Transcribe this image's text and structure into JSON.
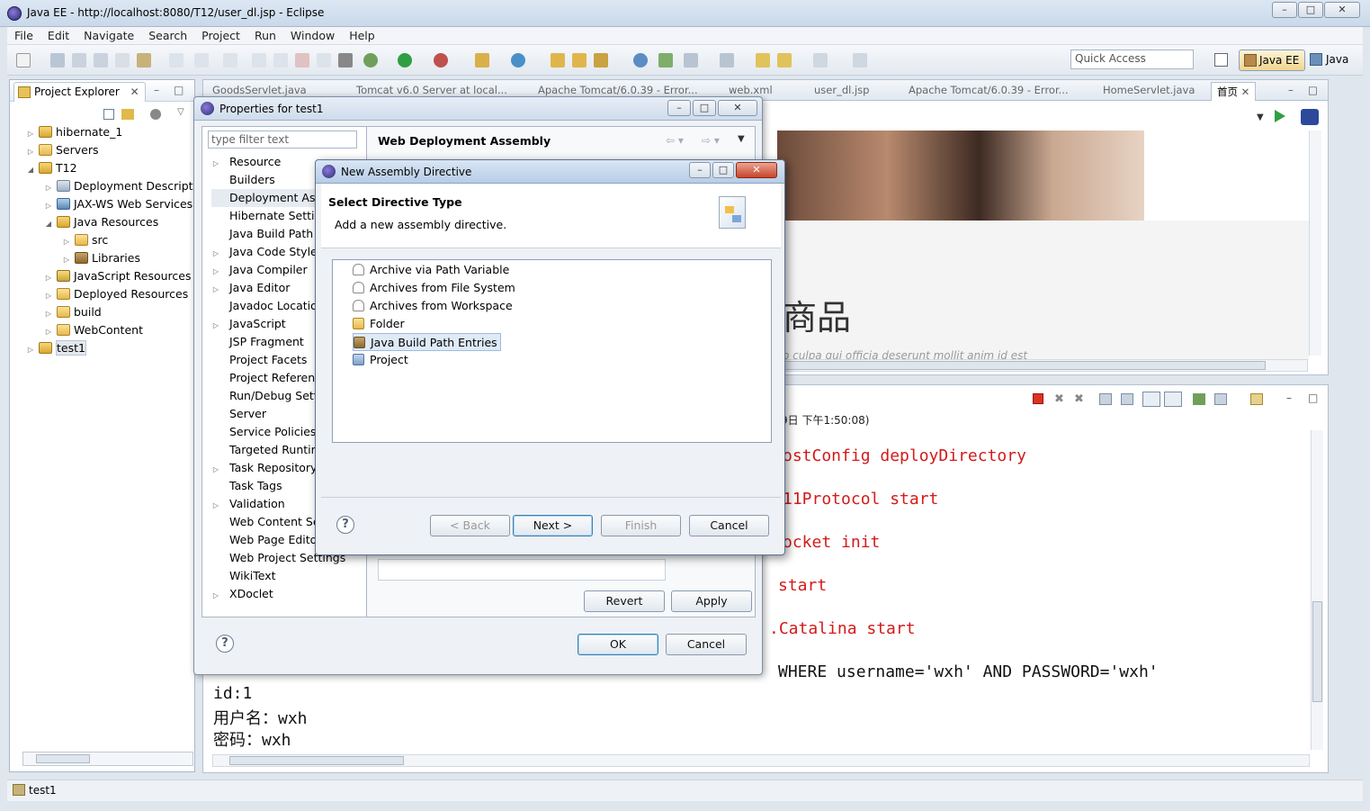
{
  "window": {
    "title": "Java EE - http://localhost:8080/T12/user_dl.jsp - Eclipse",
    "controls": [
      "–",
      "□",
      "✕"
    ]
  },
  "menu": [
    "File",
    "Edit",
    "Navigate",
    "Search",
    "Project",
    "Run",
    "Window",
    "Help"
  ],
  "toolbar": {
    "quick_access_placeholder": "Quick Access",
    "perspectives": [
      "Java EE",
      "Java"
    ]
  },
  "explorer": {
    "tab_label": "Project Explorer",
    "items": [
      {
        "label": "hibernate_1",
        "level": 0,
        "toggle": "▷",
        "icon": "project-icon"
      },
      {
        "label": "Servers",
        "level": 0,
        "toggle": "▷",
        "icon": "folder-icon"
      },
      {
        "label": "T12",
        "level": 0,
        "toggle": "◢",
        "icon": "project-icon"
      },
      {
        "label": "Deployment Descripto",
        "level": 1,
        "toggle": "▷",
        "icon": "descriptor-icon"
      },
      {
        "label": "JAX-WS Web Services",
        "level": 1,
        "toggle": "▷",
        "icon": "webservice-icon"
      },
      {
        "label": "Java Resources",
        "level": 1,
        "toggle": "◢",
        "icon": "java-resources-icon"
      },
      {
        "label": "src",
        "level": 2,
        "toggle": "▷",
        "icon": "source-folder-icon"
      },
      {
        "label": "Libraries",
        "level": 2,
        "toggle": "▷",
        "icon": "library-icon"
      },
      {
        "label": "JavaScript Resources",
        "level": 1,
        "toggle": "▷",
        "icon": "javascript-icon"
      },
      {
        "label": "Deployed Resources",
        "level": 1,
        "toggle": "▷",
        "icon": "folder-icon"
      },
      {
        "label": "build",
        "level": 1,
        "toggle": "▷",
        "icon": "folder-icon"
      },
      {
        "label": "WebContent",
        "level": 1,
        "toggle": "▷",
        "icon": "folder-icon"
      },
      {
        "label": "test1",
        "level": 0,
        "toggle": "▷",
        "icon": "project-icon"
      }
    ]
  },
  "editor_tabs": [
    "GoodsServlet.java",
    "Tomcat v6.0 Server at local...",
    "Apache Tomcat/6.0.39 - Error...",
    "web.xml",
    "user_dl.jsp",
    "Apache Tomcat/6.0.39 - Error...",
    "HomeServlet.java",
    "首页"
  ],
  "browser": {
    "heading": "商品",
    "faint_text": "o culpa qui officia deserunt mollit anim id est"
  },
  "console": {
    "title_fragment": "9日 下午1:50:08)",
    "red_lines": [
      "ostConfig deployDirectory",
      "11Protocol start",
      "ocket init",
      "start",
      ".Catalina start"
    ],
    "sql_line": "WHERE username='wxh' AND PASSWORD='wxh'",
    "lines": [
      "id:1",
      "用户名：wxh",
      "密码：wxh"
    ]
  },
  "status_bar": {
    "selection": "test1"
  },
  "properties_dialog": {
    "title": "Properties for test1",
    "filter_placeholder": "type filter text",
    "page_title": "Web Deployment Assembly",
    "nav": [
      {
        "label": "Resource",
        "expandable": true
      },
      {
        "label": "Builders",
        "expandable": false
      },
      {
        "label": "Deployment Assembly",
        "expandable": false,
        "selected": true
      },
      {
        "label": "Hibernate Settings",
        "expandable": false
      },
      {
        "label": "Java Build Path",
        "expandable": false
      },
      {
        "label": "Java Code Style",
        "expandable": true
      },
      {
        "label": "Java Compiler",
        "expandable": true
      },
      {
        "label": "Java Editor",
        "expandable": true
      },
      {
        "label": "Javadoc Location",
        "expandable": false
      },
      {
        "label": "JavaScript",
        "expandable": true
      },
      {
        "label": "JSP Fragment",
        "expandable": false
      },
      {
        "label": "Project Facets",
        "expandable": false
      },
      {
        "label": "Project References",
        "expandable": false
      },
      {
        "label": "Run/Debug Settings",
        "expandable": false
      },
      {
        "label": "Server",
        "expandable": false
      },
      {
        "label": "Service Policies",
        "expandable": false
      },
      {
        "label": "Targeted Runtimes",
        "expandable": false
      },
      {
        "label": "Task Repository",
        "expandable": true
      },
      {
        "label": "Task Tags",
        "expandable": false
      },
      {
        "label": "Validation",
        "expandable": true
      },
      {
        "label": "Web Content Settings",
        "expandable": false
      },
      {
        "label": "Web Page Editor",
        "expandable": false
      },
      {
        "label": "Web Project Settings",
        "expandable": false
      },
      {
        "label": "WikiText",
        "expandable": false
      },
      {
        "label": "XDoclet",
        "expandable": true
      }
    ],
    "buttons": {
      "revert": "Revert",
      "apply": "Apply",
      "ok": "OK",
      "cancel": "Cancel"
    },
    "help": "?"
  },
  "directive_dialog": {
    "title": "New Assembly Directive",
    "heading": "Select Directive Type",
    "description": "Add a new assembly directive.",
    "options": [
      {
        "label": "Archive via Path Variable",
        "icon": "archive-icon"
      },
      {
        "label": "Archives from File System",
        "icon": "archive-icon"
      },
      {
        "label": "Archives from Workspace",
        "icon": "archive-icon"
      },
      {
        "label": "Folder",
        "icon": "folder-icon"
      },
      {
        "label": "Java Build Path Entries",
        "icon": "library-icon",
        "selected": true
      },
      {
        "label": "Project",
        "icon": "project-icon"
      }
    ],
    "buttons": {
      "back": "< Back",
      "next": "Next >",
      "finish": "Finish",
      "cancel": "Cancel"
    },
    "help": "?"
  }
}
